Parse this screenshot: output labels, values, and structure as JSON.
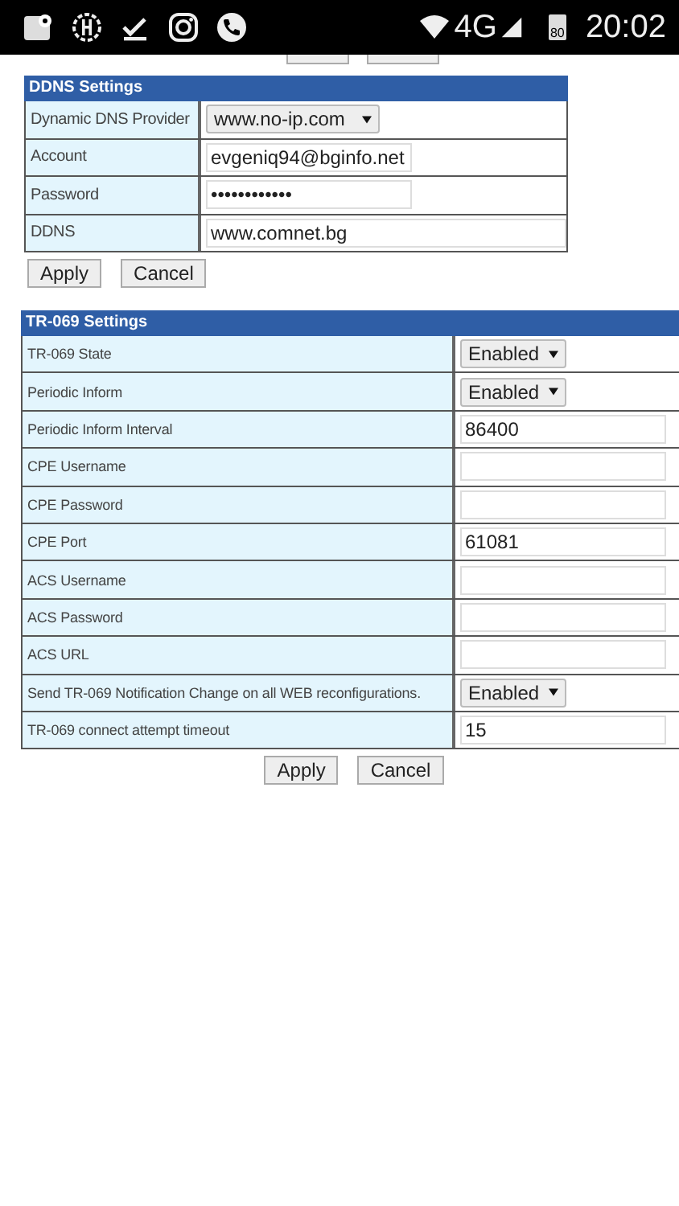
{
  "status_bar": {
    "network": "4G",
    "battery": "80",
    "time": "20:02"
  },
  "ddns": {
    "title": "DDNS Settings",
    "rows": [
      {
        "label": "Dynamic DNS Provider",
        "kind": "select",
        "value": "www.no-ip.com"
      },
      {
        "label": "Account",
        "kind": "text",
        "value": "evgeniq94@bginfo.net"
      },
      {
        "label": "Password",
        "kind": "text",
        "value": "••••••••••••"
      },
      {
        "label": "DDNS",
        "kind": "wide",
        "value": "www.comnet.bg"
      }
    ],
    "buttons": [
      "Apply",
      "Cancel"
    ]
  },
  "tr069": {
    "title": "TR-069 Settings",
    "rows": [
      {
        "label": "TR-069 State",
        "kind": "select",
        "value": "Enabled"
      },
      {
        "label": "Periodic Inform",
        "kind": "select",
        "value": "Enabled"
      },
      {
        "label": "Periodic Inform Interval",
        "kind": "text",
        "value": "86400"
      },
      {
        "label": "CPE Username",
        "kind": "text"
      },
      {
        "label": "CPE Password",
        "kind": "text"
      },
      {
        "label": "CPE Port",
        "kind": "text",
        "value": "61081"
      },
      {
        "label": "ACS Username",
        "kind": "text"
      },
      {
        "label": "ACS Password",
        "kind": "text"
      },
      {
        "label": "ACS URL",
        "kind": "text"
      },
      {
        "label": "Send TR-069 Notification Change on all WEB reconfigurations.",
        "kind": "select",
        "value": "Enabled"
      },
      {
        "label": "TR-069 connect attempt timeout",
        "kind": "text",
        "value": "15"
      }
    ],
    "buttons": [
      "Apply",
      "Cancel"
    ]
  }
}
